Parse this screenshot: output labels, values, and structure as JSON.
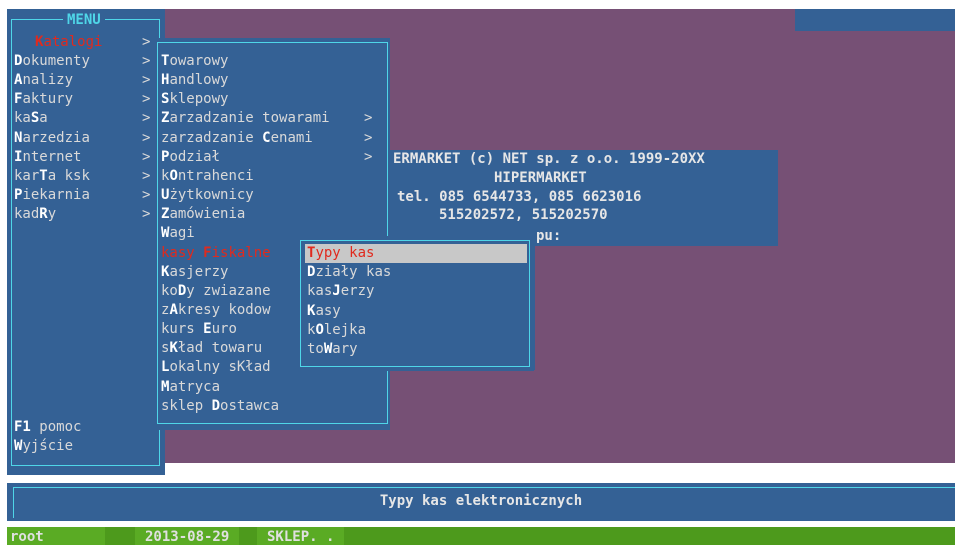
{
  "main_menu": {
    "title": "MENU",
    "items": [
      {
        "label": "Katalogi",
        "hotkey_index": 0,
        "arrow": ">",
        "selected": true
      },
      {
        "label": "Dokumenty",
        "hotkey_index": 0,
        "arrow": ">"
      },
      {
        "label": "Analizy",
        "hotkey_index": 0,
        "arrow": ">"
      },
      {
        "label": "Faktury",
        "hotkey_index": 0,
        "arrow": ">"
      },
      {
        "label": "kaSa",
        "hotkey_index": 2,
        "arrow": ">"
      },
      {
        "label": "Narzedzia",
        "hotkey_index": 0,
        "arrow": ">"
      },
      {
        "label": "Internet",
        "hotkey_index": 0,
        "arrow": ">"
      },
      {
        "label": "karTa ksk",
        "hotkey_index": 3,
        "arrow": ">"
      },
      {
        "label": "Piekarnia",
        "hotkey_index": 0,
        "arrow": ">"
      },
      {
        "label": "kadRy",
        "hotkey_index": 3,
        "arrow": ">"
      }
    ],
    "footer_items": [
      {
        "label": "F1 pomoc",
        "hotkey_len": 2
      },
      {
        "label": "Wyjście",
        "hotkey_index": 0
      }
    ]
  },
  "katalogi_submenu": {
    "items": [
      {
        "label": "Towarowy",
        "hotkey_index": 0,
        "arrow": ""
      },
      {
        "label": "Handlowy",
        "hotkey_index": 0,
        "arrow": ""
      },
      {
        "label": "Sklepowy",
        "hotkey_index": 0,
        "arrow": ""
      },
      {
        "label": "Zarzadzanie towarami",
        "hotkey_index": 0,
        "arrow": ">"
      },
      {
        "label": "zarzadzanie Cenami",
        "hotkey_index": 12,
        "arrow": ">"
      },
      {
        "label": "Podział",
        "hotkey_index": 0,
        "arrow": ">"
      },
      {
        "label": "kOntrahenci",
        "hotkey_index": 1,
        "arrow": ""
      },
      {
        "label": "Użytkownicy",
        "hotkey_index": 0,
        "arrow": ""
      },
      {
        "label": "Zamówienia",
        "hotkey_index": 0,
        "arrow": ""
      },
      {
        "label": "Wagi",
        "hotkey_index": 0,
        "arrow": ""
      },
      {
        "label": "kasy Fiskalne",
        "hotkey_index": 5,
        "arrow": "",
        "selected": true
      },
      {
        "label": "Kasjerzy",
        "hotkey_index": 0,
        "arrow": ""
      },
      {
        "label": "koDy zwiazane",
        "hotkey_index": 2,
        "arrow": ""
      },
      {
        "label": "zAkresy kodow",
        "hotkey_index": 1,
        "arrow": ""
      },
      {
        "label": "kurs Euro",
        "hotkey_index": 5,
        "arrow": ""
      },
      {
        "label": "sKład towaru",
        "hotkey_index": 1,
        "arrow": ""
      },
      {
        "label": "Lokalny sKład",
        "hotkey_index": 0,
        "arrow": ""
      },
      {
        "label": "Matryca",
        "hotkey_index": 0,
        "arrow": ""
      },
      {
        "label": "sklep Dostawca",
        "hotkey_index": 6,
        "arrow": ""
      }
    ]
  },
  "kasy_submenu": {
    "items": [
      {
        "label": "Typy kas",
        "hotkey_index": 0,
        "selected": true
      },
      {
        "label": "Działy kas",
        "hotkey_index": 0
      },
      {
        "label": "kasJerzy",
        "hotkey_index": 3
      },
      {
        "label": "Kasy",
        "hotkey_index": 0
      },
      {
        "label": "kOlejka",
        "hotkey_index": 1
      },
      {
        "label": "toWary",
        "hotkey_index": 2
      }
    ]
  },
  "info_panel": {
    "line1": "ERMARKET (c) NET sp. z o.o. 1999-20XX",
    "line2": "HIPERMARKET",
    "line3": "tel. 085 6544733, 085 6623016",
    "line4": "515202572, 515202570",
    "line5": "pu:"
  },
  "status": {
    "text": "Typy kas elektronicznych"
  },
  "bottom_bar": {
    "user": "root",
    "date": "2013-08-29",
    "shop": "SKLEP. ."
  },
  "colors": {
    "desktop": "#765075",
    "panel": "#346195",
    "frame": "#4fd6e8",
    "selected_text": "#e02a1e",
    "highlight_bg": "#c8c8c8",
    "bottom_bar": "#4d9a1c"
  }
}
